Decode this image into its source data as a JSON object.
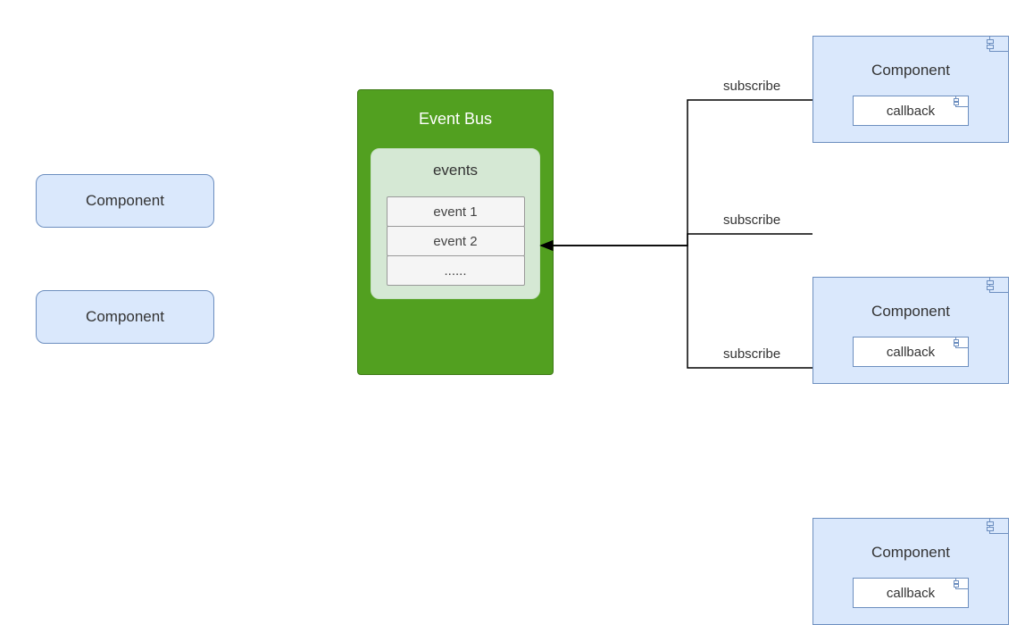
{
  "left": {
    "componentLabel": "Component"
  },
  "eventBus": {
    "title": "Event Bus",
    "eventsLabel": "events",
    "rows": [
      "event 1",
      "event 2",
      "......"
    ]
  },
  "right": {
    "componentLabel": "Component",
    "callbackLabel": "callback",
    "edgeLabel": "subscribe"
  },
  "colors": {
    "componentFill": "#dae8fc",
    "componentStroke": "#6c8ebf",
    "busFill": "#52a020",
    "eventsInnerFill": "#d5e8d4",
    "rowFill": "#f5f5f5",
    "arrow": "#000000"
  },
  "chart_data": {
    "type": "diagram",
    "title": "Event Bus publish/subscribe component diagram",
    "nodes": [
      {
        "id": "compL1",
        "kind": "component",
        "label": "Component",
        "side": "left"
      },
      {
        "id": "compL2",
        "kind": "component",
        "label": "Component",
        "side": "left"
      },
      {
        "id": "bus",
        "kind": "event-bus",
        "label": "Event Bus",
        "events_container_label": "events",
        "events": [
          "event 1",
          "event 2",
          "......"
        ]
      },
      {
        "id": "compR1",
        "kind": "component-with-callback",
        "label": "Component",
        "callback": "callback",
        "side": "right"
      },
      {
        "id": "compR2",
        "kind": "component-with-callback",
        "label": "Component",
        "callback": "callback",
        "side": "right"
      },
      {
        "id": "compR3",
        "kind": "component-with-callback",
        "label": "Component",
        "callback": "callback",
        "side": "right"
      }
    ],
    "edges": [
      {
        "from": "compR1",
        "to": "bus.events[0]",
        "label": "subscribe",
        "style": "elbow-arrow"
      },
      {
        "from": "compR2",
        "to": "bus.events[0]",
        "label": "subscribe",
        "style": "elbow-arrow"
      },
      {
        "from": "compR3",
        "to": "bus.events[0]",
        "label": "subscribe",
        "style": "elbow-arrow"
      }
    ]
  }
}
